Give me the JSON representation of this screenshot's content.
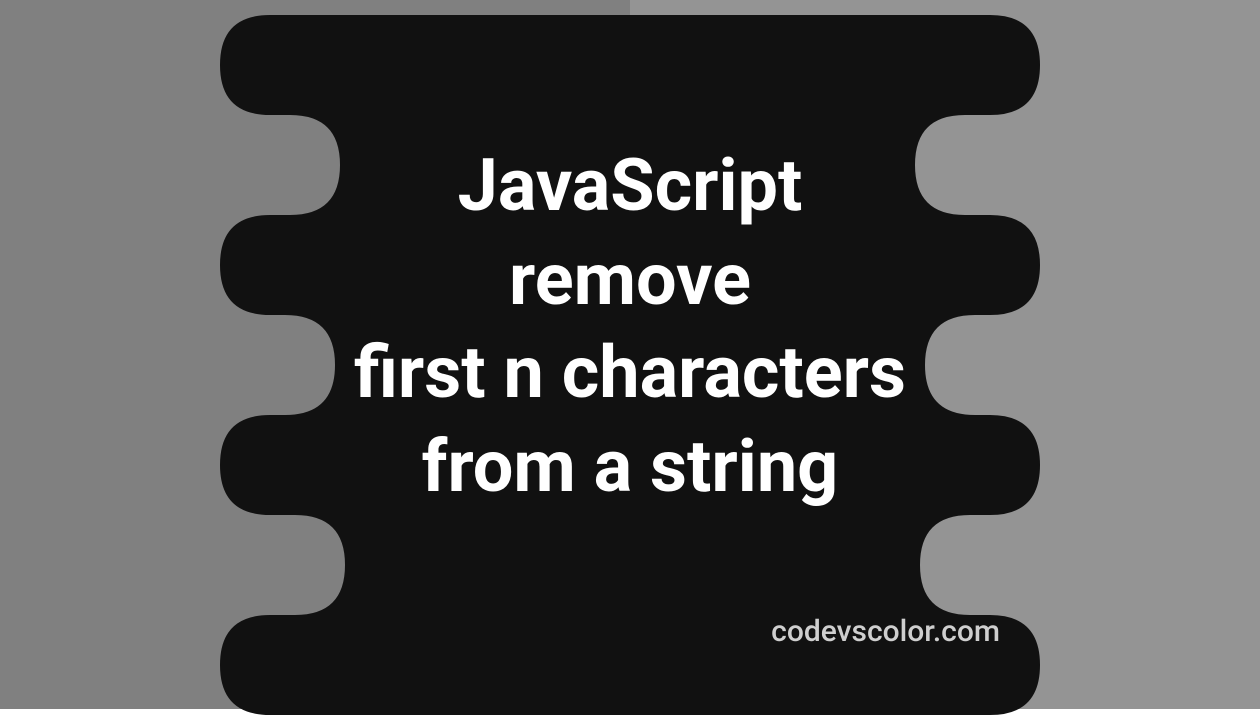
{
  "title": {
    "line1": "JavaScript",
    "line2": "remove",
    "line3": "first n characters",
    "line4": "from a string"
  },
  "watermark": "codevscolor.com",
  "colors": {
    "bg_left": "#808080",
    "bg_right": "#949494",
    "blob": "#111111",
    "text": "#ffffff",
    "watermark": "#cfcfcf"
  }
}
